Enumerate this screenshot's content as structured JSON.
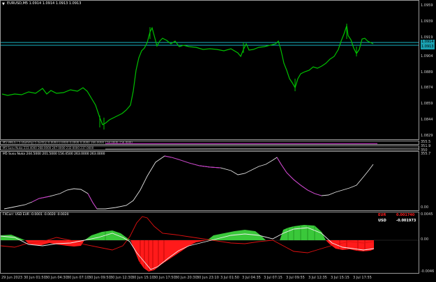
{
  "main_pane": {
    "title": "EURUSD,M5  1.0914 1.0914 1.0913 1.0913",
    "price_ticks": [
      "1.0959",
      "1.0939",
      "1.0919",
      "1.0904",
      "1.0889",
      "1.0874",
      "1.0859",
      "1.0844",
      "1.0829"
    ],
    "price_tags": [
      "1.0914",
      "1.0913"
    ],
    "colors": {
      "candles": "#00c000",
      "hline": "#18b5c5"
    }
  },
  "indicator_strips": {
    "line1": "M5 996.6 / 5 (dummy) 5 (Entry) 0.0000 0.0000 0.0000 0.0000 166.0000 158.0000 156.0000",
    "line2": "M5 Susu Nuka 233.4000 268.0000 247.0000 232.0000 237.0000",
    "ticks": [
      "355.5",
      "351.9",
      "350"
    ]
  },
  "susu_pane": {
    "title": "M5 Susu Nuka  244.5000 201.5000 156.4500 263.0000 263.0000",
    "ticks": [
      "355.7",
      "0.00"
    ]
  },
  "fxcorr_pane": {
    "title": "FXCorr:  USD EUR -0.0001 -0.0020 -0.0020",
    "ticks": [
      "0.0045",
      "0.00",
      "-0.0046"
    ],
    "legend": [
      {
        "label": "EUR",
        "value": "0.001740",
        "color": "#ff2020"
      },
      {
        "label": "USD",
        "value": "-0.001973",
        "color": "#ffffff"
      }
    ]
  },
  "time_axis": [
    "29 Jun 2023",
    "30 Jun 01:50",
    "30 Jun 04:30",
    "30 Jun 07:10",
    "30 Jun 09:50",
    "30 Jun 12:30",
    "30 Jun 15:10",
    "30 Jun 17:50",
    "30 Jun 20:30",
    "30 Jun 23:10",
    "3 Jul 01:50",
    "3 Jul 04:35",
    "3 Jul 07:15",
    "3 Jul 09:55",
    "3 Jul 12:35",
    "3 Jul 15:15",
    "3 Jul 17:55"
  ]
}
